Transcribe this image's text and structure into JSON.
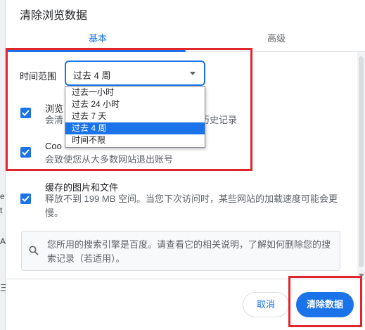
{
  "background_fragments": [
    "e",
    "t",
    "A",
    "三"
  ],
  "dialog": {
    "title": "清除浏览数据",
    "tabs": [
      {
        "label": "基本",
        "active": true
      },
      {
        "label": "高级",
        "active": false
      }
    ],
    "time_range": {
      "label": "时间范围",
      "selected": "过去 4 周",
      "options": [
        "过去一小时",
        "过去 24 小时",
        "过去 7 天",
        "过去 4 周",
        "时间不限"
      ],
      "selected_index": 3
    },
    "items": [
      {
        "title": "浏览",
        "description": "会清",
        "description_tail": "历史记录",
        "checked": true
      },
      {
        "title": "Coo",
        "description": "会致使您从大多数网站退出账号",
        "checked": true
      },
      {
        "title": "缓存的图片和文件",
        "description": "释放不到 199 MB 空间。当您下次访问时，某些网站的加载速度可能会更慢。",
        "checked": true
      }
    ],
    "info_text": "您所用的搜索引擎是百度。请查看它的相关说明，了解如何删除您的搜索记录（若适用）。",
    "buttons": {
      "cancel": "取消",
      "clear": "清除数据"
    }
  },
  "colors": {
    "accent": "#1a73e8",
    "highlight_box": "#e0262c"
  }
}
